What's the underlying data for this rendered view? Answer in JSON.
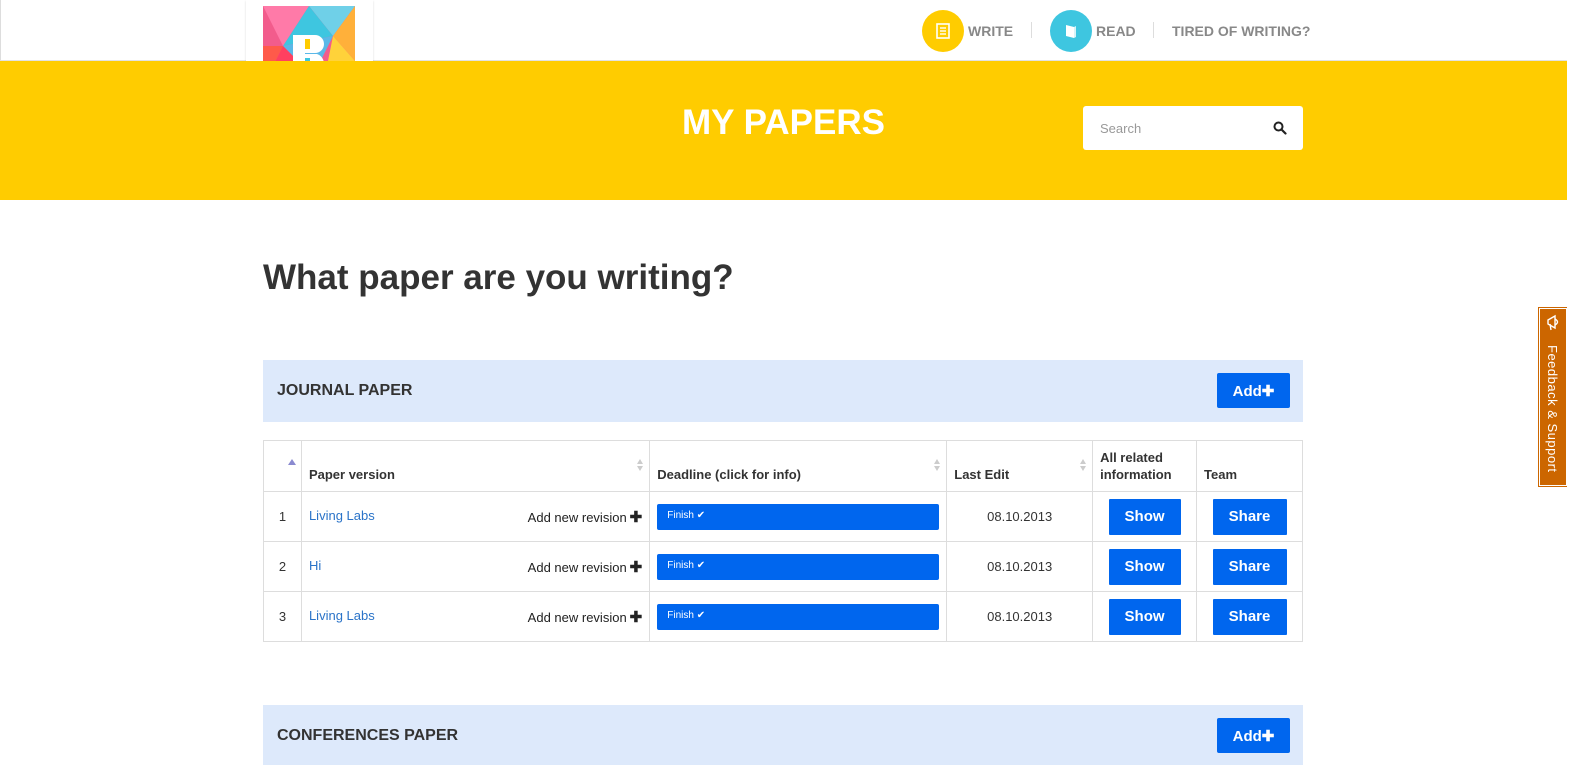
{
  "nav": {
    "write_label": "WRITE",
    "read_label": "READ",
    "tired_label": "TIRED OF WRITING?"
  },
  "banner": {
    "title": "MY PAPERS",
    "search_placeholder": "Search"
  },
  "main": {
    "question": "What paper are you writing?"
  },
  "sections": {
    "journal": {
      "label": "JOURNAL PAPER",
      "add_label": "Add✚"
    },
    "conferences": {
      "label": "CONFERENCES PAPER",
      "add_label": "Add✚"
    }
  },
  "table": {
    "headers": {
      "paper_version": "Paper version",
      "deadline": "Deadline (click for info)",
      "last_edit": "Last Edit",
      "all_related": "All related information",
      "team": "Team"
    },
    "rows": [
      {
        "num": "1",
        "title": "Living Labs",
        "add_revision": "Add new revision",
        "deadline": "Finish ✔",
        "last_edit": "08.10.2013",
        "show": "Show",
        "share": "Share"
      },
      {
        "num": "2",
        "title": "Hi",
        "add_revision": "Add new revision",
        "deadline": "Finish ✔",
        "last_edit": "08.10.2013",
        "show": "Show",
        "share": "Share"
      },
      {
        "num": "3",
        "title": "Living Labs",
        "add_revision": "Add new revision",
        "deadline": "Finish ✔",
        "last_edit": "08.10.2013",
        "show": "Show",
        "share": "Share"
      }
    ]
  },
  "feedback": {
    "label": "Feedback & Support"
  },
  "icons": {
    "write": "document-icon",
    "read": "book-icon",
    "search": "search-icon",
    "feedback": "megaphone-icon"
  },
  "colors": {
    "brand_yellow": "#ffcc00",
    "accent_blue": "#0066ee",
    "section_bg": "#dde9fb",
    "read_cyan": "#3ec6e0",
    "feedback_orange": "#cc6600",
    "link_blue": "#2a73c8"
  }
}
